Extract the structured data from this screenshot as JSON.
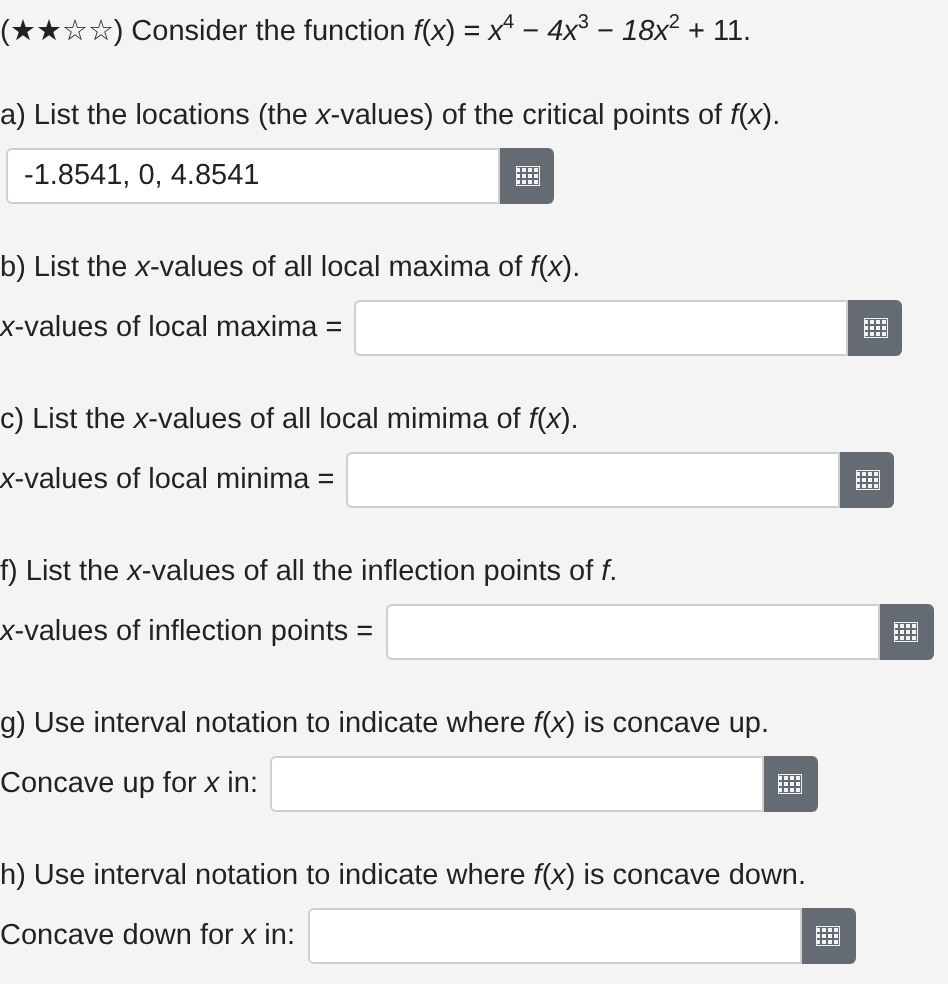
{
  "title": "(★★☆☆) Consider the function *f*(*x*) = *x*$^{4}$ − *4x*$^{3}$ − *18x*$^{2}$ + 11.",
  "parts": [
    {
      "question": "a) List the locations (the *x*-values) of the critical points of *f*(*x*).",
      "value": "-1.8541, 0, 4.8541"
    },
    {
      "question": "b) List the *x*-values of all local maxima of *f*(*x*).",
      "label": "*x*-values of local maxima ="
    },
    {
      "question": "c) List the *x*-values of all local mimima of *f*(*x*).",
      "label": "*x*-values of local minima ="
    },
    {
      "question": "f) List the *x*-values of all the inflection points of *f*.",
      "label": "*x*-values of inflection points ="
    },
    {
      "question": "g) Use interval notation to indicate where *f*(*x*) is concave up.",
      "label": "Concave up for *x* in:"
    },
    {
      "question": "h) Use interval notation to indicate where *f*(*x*) is concave down.",
      "label": "Concave down for *x* in:"
    }
  ]
}
